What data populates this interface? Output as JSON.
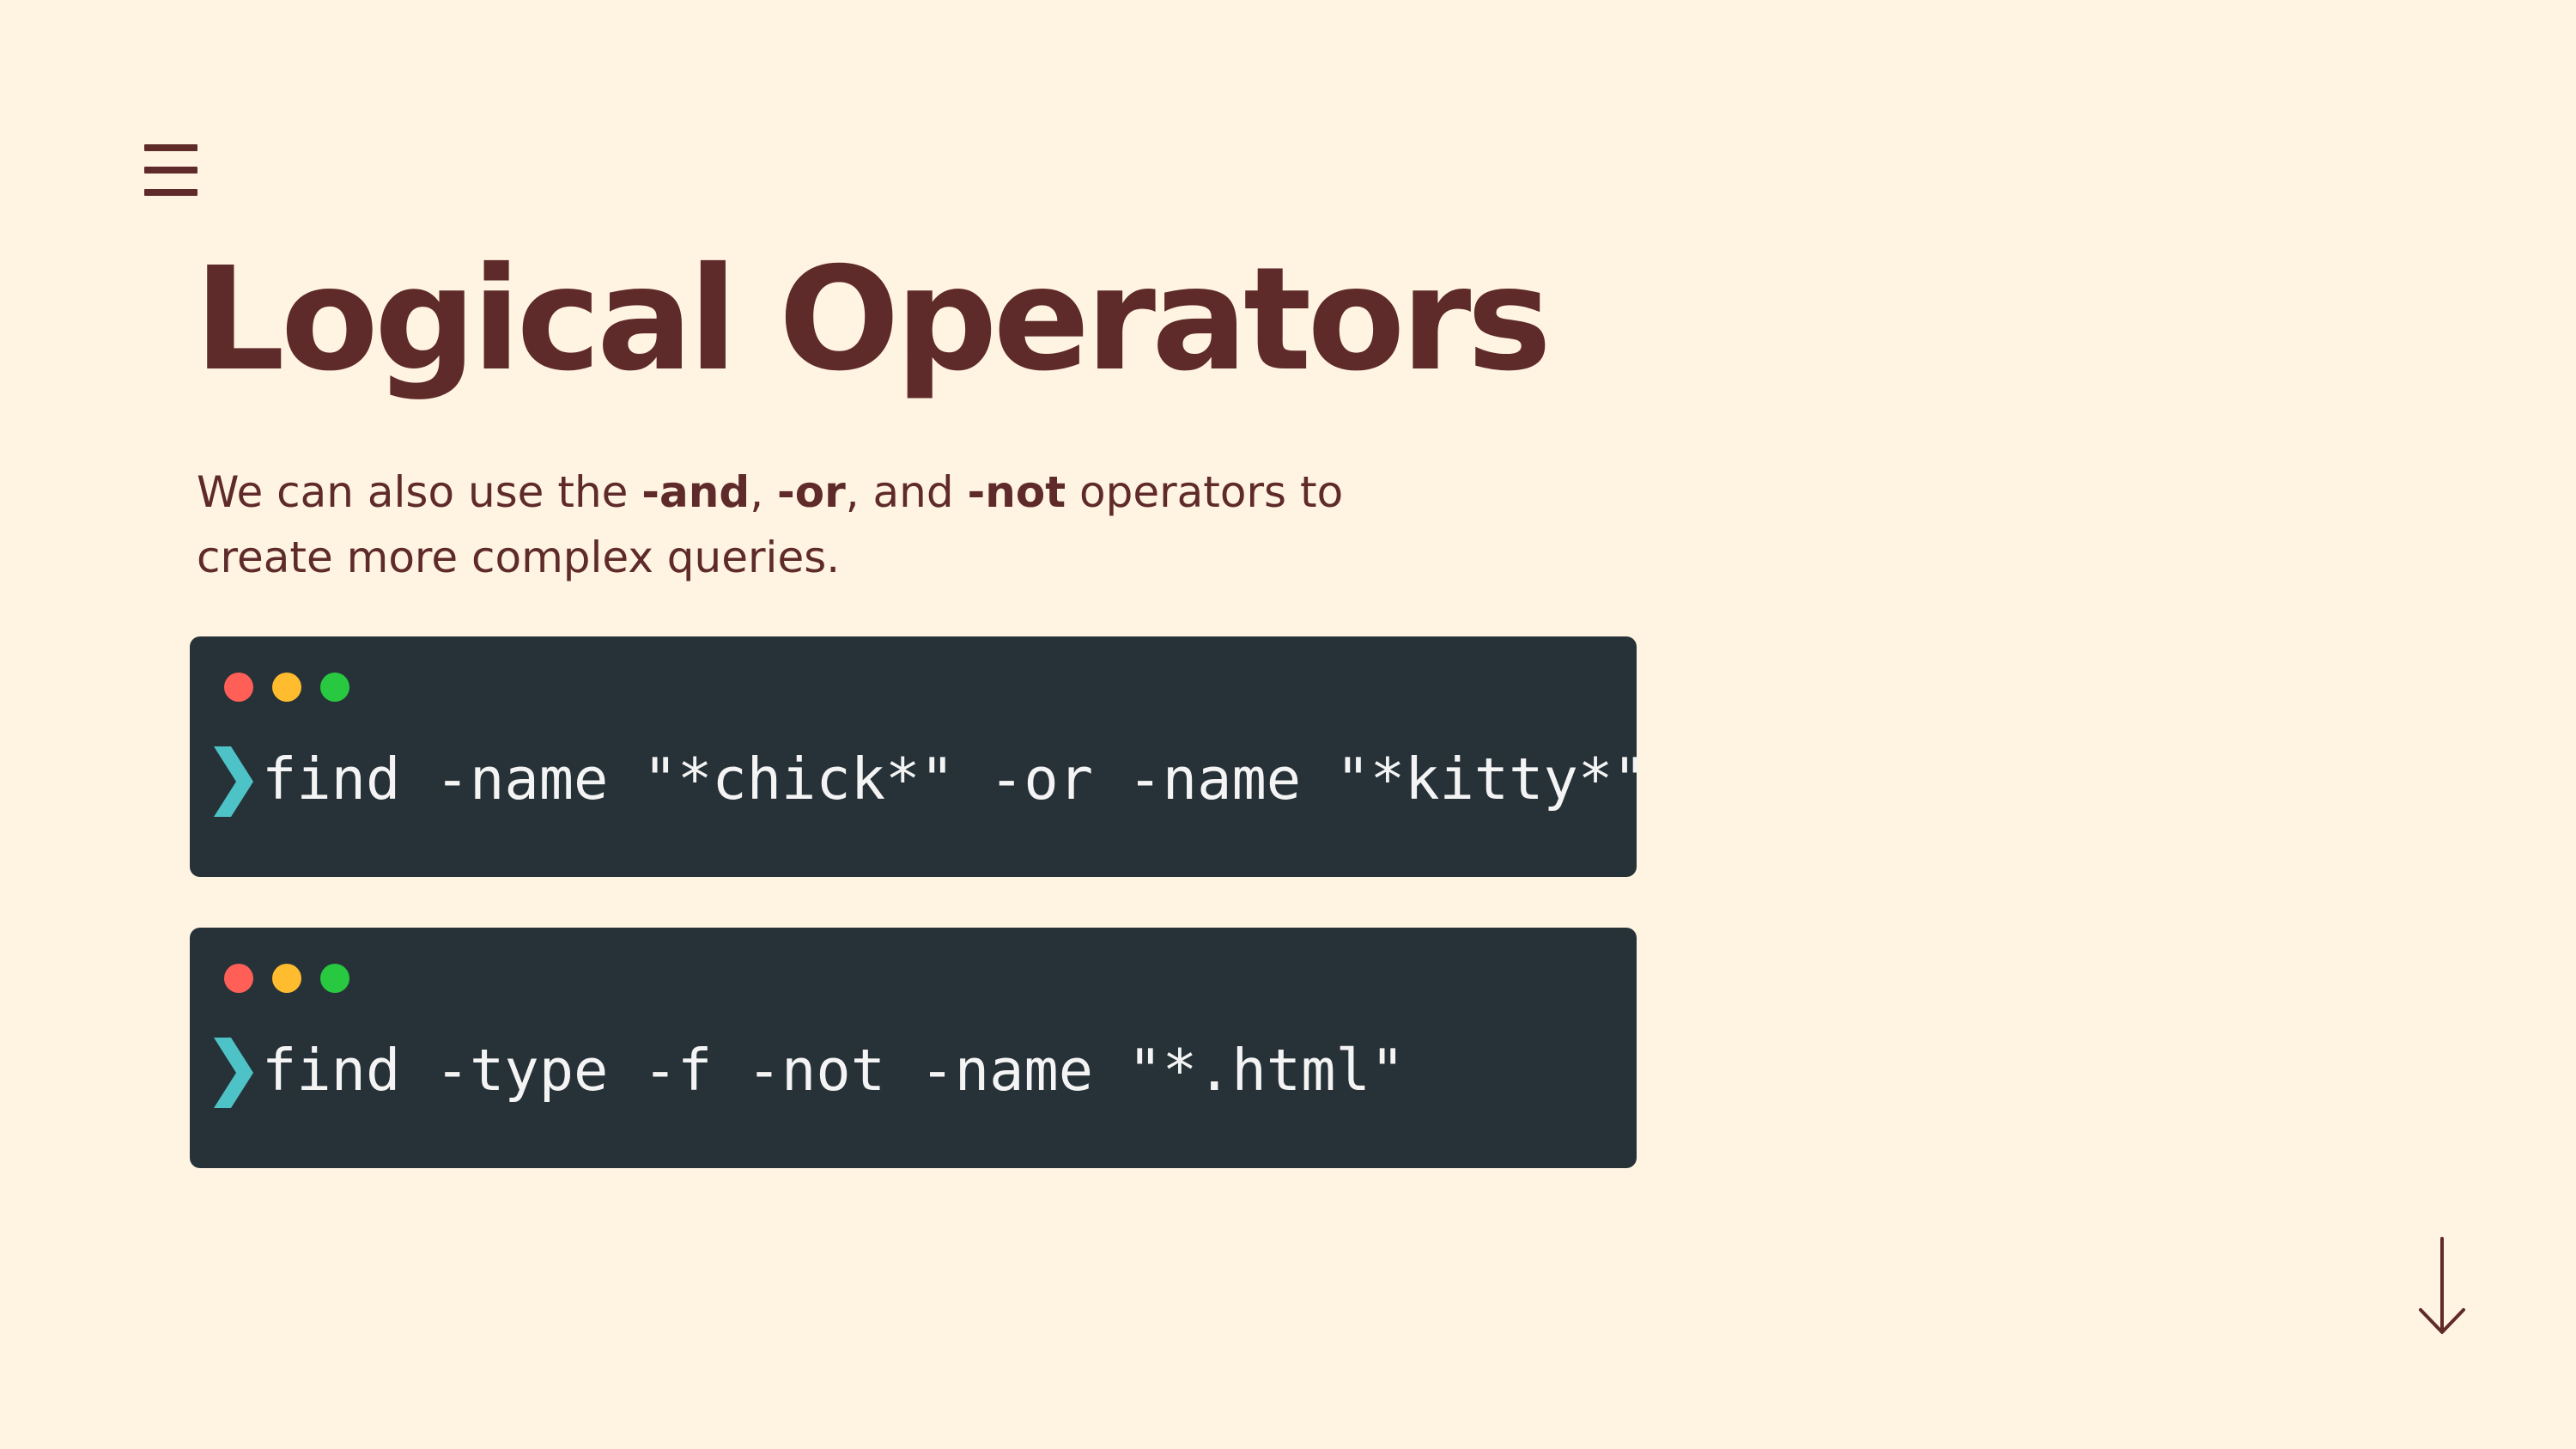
{
  "slide": {
    "title": "Logical Operators",
    "description": {
      "text_1": "We can also use the ",
      "op_and": "-and",
      "text_2": ", ",
      "op_or": "-or",
      "text_3": ", and ",
      "op_not": "-not",
      "text_4": " operators to create more complex queries."
    }
  },
  "terminals": [
    {
      "command": "find -name \"*chick*\" -or -name \"*kitty*\""
    },
    {
      "command": "find -type -f -not -name \"*.html\""
    }
  ],
  "icons": {
    "menu": "hamburger-menu-icon",
    "prompt": "chevron-right-icon",
    "next": "arrow-down-icon",
    "window_controls": [
      "close-dot",
      "minimize-dot",
      "maximize-dot"
    ]
  },
  "colors": {
    "background": "#FFF3E1",
    "text": "#5E2A2A",
    "terminal_bg": "#273238",
    "terminal_text": "#F4F4F4",
    "prompt_accent": "#4DC3C8",
    "dot_red": "#FF5F57",
    "dot_yellow": "#FEBC2E",
    "dot_green": "#28C840"
  }
}
